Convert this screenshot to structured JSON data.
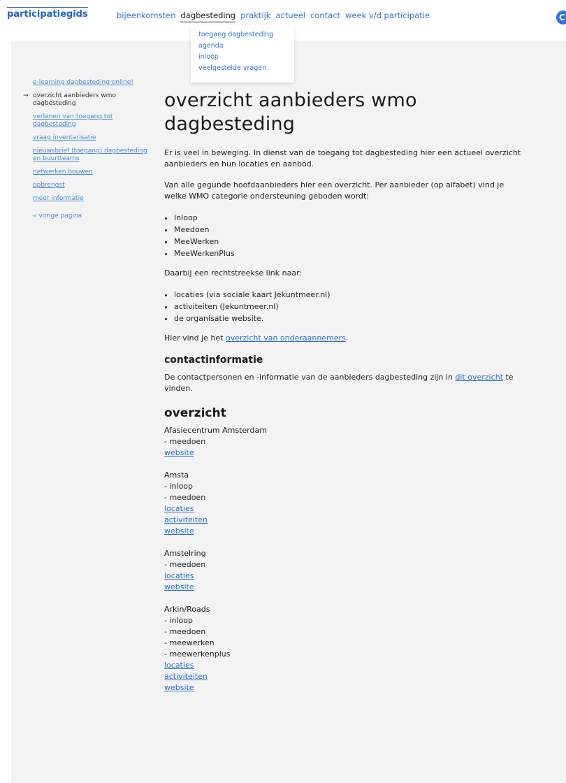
{
  "header": {
    "logo": "participatiegids",
    "nav": [
      {
        "label": "bijeenkomsten",
        "active": false
      },
      {
        "label": "dagbesteding",
        "active": true
      },
      {
        "label": "praktijk",
        "active": false
      },
      {
        "label": "actueel",
        "active": false
      },
      {
        "label": "contact",
        "active": false
      },
      {
        "label": "week v/d participatie",
        "active": false
      }
    ],
    "profile_initial": "C"
  },
  "dropdown": {
    "items": [
      "toegang dagbesteding",
      "agenda",
      "inloop",
      "veelgestelde vragen"
    ]
  },
  "sidebar": {
    "items": [
      {
        "label": "e-learning dagbesteding online!",
        "current": false
      },
      {
        "label": "overzicht aanbieders wmo dagbesteding",
        "current": true
      },
      {
        "label": "verlenen van toegang tot dagbesteding",
        "current": false
      },
      {
        "label": "vraag inventarisatie",
        "current": false
      },
      {
        "label": "nieuwsbrief (toegang) dagbesteding en buurtteams",
        "current": false
      },
      {
        "label": "netwerken bouwen",
        "current": false
      },
      {
        "label": "opbrengst",
        "current": false
      },
      {
        "label": "meer informatie",
        "current": false
      }
    ],
    "current_marker": "→",
    "back_label": "« vorige pagina"
  },
  "main": {
    "title": "overzicht aanbieders wmo dagbesteding",
    "intro": "Er is veel in beweging. In dienst van de toegang tot dagbesteding hier een actueel overzicht aanbieders en hun locaties en aanbod.",
    "para2": "Van alle gegunde hoofdaanbieders hier een overzicht. Per aanbieder (op alfabet) vind je welke WMO categorie ondersteuning geboden wordt:",
    "categories": [
      "Inloop",
      "Meedoen",
      "MeeWerken",
      "MeeWerkenPlus"
    ],
    "link_intro": "Daarbij een rechtstreekse link naar:",
    "link_types": [
      "locaties (via sociale kaart Jekuntmeer.nl)",
      "activiteiten (Jekuntmeer.nl)",
      "de organisatie website."
    ],
    "subcontractors_pre": "Hier vind je het ",
    "subcontractors_link": "overzicht van onderaannemers",
    "subcontractors_post": ".",
    "contact_heading": "contactinformatie",
    "contact_pre": "De contactpersonen en -informatie van de aanbieders dagbesteding zijn in ",
    "contact_link": "dit overzicht",
    "contact_post": " te vinden.",
    "overview_heading": "overzicht",
    "providers": [
      {
        "name": "Afasiecentrum Amsterdam",
        "lines": [
          "- meedoen"
        ],
        "links": [
          "website"
        ]
      },
      {
        "name": "Amsta",
        "lines": [
          "- inloop",
          "- meedoen"
        ],
        "links": [
          "locaties",
          "activiteiten",
          "website"
        ]
      },
      {
        "name": "Amstelring",
        "lines": [
          "- meedoen"
        ],
        "links": [
          "locaties",
          "website"
        ]
      },
      {
        "name": "Arkin/Roads",
        "lines": [
          "- inloop",
          "- meedoen",
          "- meewerken",
          "- meewerkenplus"
        ],
        "links": [
          "locaties",
          "activiteiten",
          "website"
        ]
      }
    ]
  }
}
